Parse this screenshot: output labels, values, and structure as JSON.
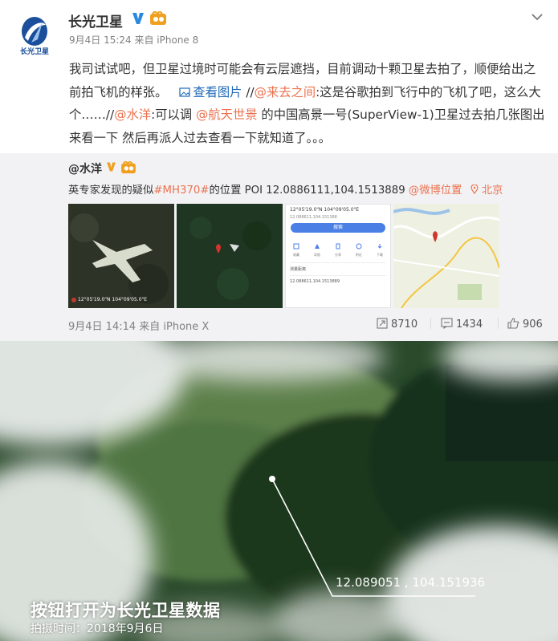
{
  "post": {
    "author": "长光卫星",
    "avatar_caption": "长光卫星",
    "time": "9月4日 15:24 来自 iPhone 8",
    "text_parts": {
      "p1": "我司试试吧，但卫星过境时可能会有云层遮挡，目前调动十颗卫星去拍了，顺便给出之前拍飞机的样张。",
      "view_images": "查看图片",
      "p2": " //",
      "mention1": "@来去之间",
      "p3": ":这是谷歌拍到飞行中的飞机了吧，这么大个……//",
      "mention2": "@水洋",
      "p4": ":可以调 ",
      "mention3": "@航天世景",
      "p5": " 的中国高景一号(SuperView-1)卫星过去拍几张图出来看一下 然后再派人过去查看一下就知道了。。。"
    }
  },
  "repost": {
    "author": "@水洋",
    "text_parts": {
      "t1": "英专家发现的疑似",
      "hashtag": "#MH370#",
      "t2": "的位置 POI 12.0886111,104.1513889 ",
      "at_location": "@微博位置",
      "location": "北京"
    },
    "time": "9月4日 14:14 来自 iPhone X",
    "reposts": "8710",
    "comments": "1434",
    "likes": "906",
    "thumb1_coords": "12°05'19.0\"N 104°09'05.0\"E",
    "thumb3": {
      "coords": "12°05'19.0\"N 104°09'05.0\"E",
      "sub": "12.088611,104.151388",
      "button": "搜索",
      "icon_labels": [
        "收藏",
        "导航",
        "分享",
        "附近",
        "下载"
      ],
      "row_label": "测量距离",
      "row_value": "12.088611,104.1513889"
    }
  },
  "satellite": {
    "coords": "12.089051 , 104.151936",
    "caption": "按钮打开为长光卫星数据",
    "subcaption": "拍摄时间：2018年9月6日"
  },
  "colors": {
    "link_orange": "#eb7350",
    "link_blue": "#1f6ab9",
    "verified_blue": "#2b8ae0",
    "vip_orange": "#f0a020"
  }
}
